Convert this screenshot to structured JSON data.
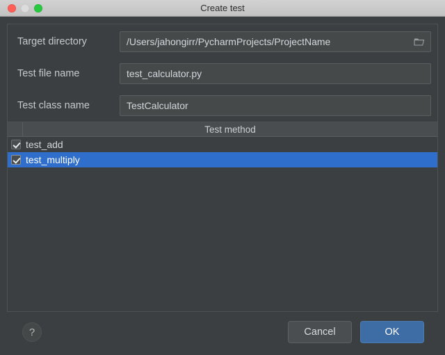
{
  "window": {
    "title": "Create test",
    "controls": [
      {
        "name": "close",
        "color": "#ff5f57"
      },
      {
        "name": "minimize",
        "color": "#dcdcdc"
      },
      {
        "name": "zoom",
        "color": "#28c840"
      }
    ]
  },
  "form": {
    "fields": [
      {
        "label": "Target directory",
        "value": "/Users/jahongirr/PycharmProjects/ProjectName",
        "has_browse": true,
        "browse_icon": "folder-icon"
      },
      {
        "label": "Test file name",
        "value": "test_calculator.py",
        "has_browse": false
      },
      {
        "label": "Test class name",
        "value": "TestCalculator",
        "has_browse": false
      }
    ]
  },
  "table": {
    "header": "Test method",
    "rows": [
      {
        "label": "test_add",
        "checked": true,
        "selected": false
      },
      {
        "label": "test_multiply",
        "checked": true,
        "selected": true
      }
    ]
  },
  "footer": {
    "help_label": "?",
    "cancel_label": "Cancel",
    "ok_label": "OK",
    "ok_color": "#3e6ca4"
  }
}
